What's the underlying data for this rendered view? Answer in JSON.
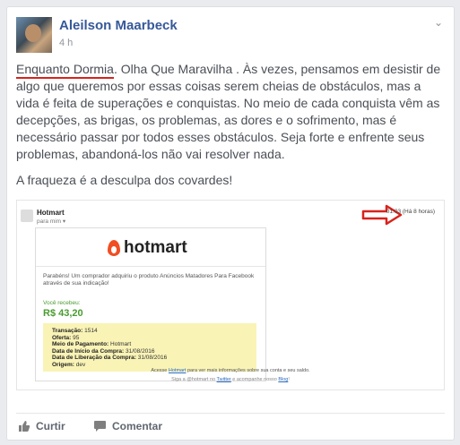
{
  "post": {
    "author": "Aleilson Maarbeck",
    "time": "4 h",
    "highlight": "Enquanto Dormia",
    "text_rest": ". Olha Que Maravilha . Às vezes, pensamos em desistir de algo que queremos por essas coisas serem cheias de obstáculos, mas a vida é feita de superações e conquistas. No meio de cada conquista vêm as decepções, as brigas, os problemas, as dores e o sofrimento, mas é necessário passar por todos esses obstáculos. Seja forte e enfrente seus problemas, abandoná-los não vai resolver nada.",
    "text2": "A fraqueza é a desculpa dos covardes!"
  },
  "email": {
    "sender": "Hotmart",
    "to": "para mim ▾",
    "time": "01:03 (Há 8 horas)",
    "brand": "hotmart",
    "message": "Parabéns! Um comprador adquiriu o produto Anúncios Matadores Para Facebook através de sua indicação!",
    "received_label": "Você recebeu:",
    "amount": "R$ 43,20",
    "details": {
      "transacao_label": "Transação:",
      "transacao_value": "1514",
      "oferta_label": "Oferta:",
      "oferta_value": "95",
      "pagamento_label": "Meio de Pagamento:",
      "pagamento_value": "Hotmart",
      "inicio_label": "Data de Início da Compra:",
      "inicio_value": "31/08/2016",
      "liberacao_label": "Data de Liberação da Compra:",
      "liberacao_value": "31/08/2016",
      "origem_label": "Origem:",
      "origem_value": "dev"
    },
    "footer1_pre": "Acesse ",
    "footer1_link": "Hotmart",
    "footer1_post": " para ver mais informações sobre sua conta e seu saldo.",
    "footer2_pre": "Siga a @hotmart no ",
    "footer2_link1": "Twitter",
    "footer2_mid": " e acompanhe nosso ",
    "footer2_link2": "Blog",
    "footer2_post": "!"
  },
  "actions": {
    "like": "Curtir",
    "comment": "Comentar"
  },
  "colors": {
    "author": "#365899",
    "highlight_underline": "#d9221c",
    "arrow": "#d9221c",
    "hotmart": "#f04e23",
    "amount": "#4a9b2f"
  }
}
